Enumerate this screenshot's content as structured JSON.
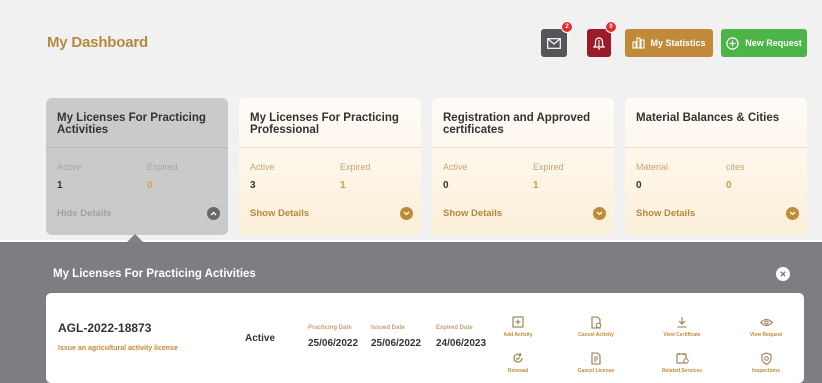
{
  "header": {
    "title": "My Dashboard",
    "mail_badge": "2",
    "notif_badge": "0",
    "stats_label": "My Statistics",
    "new_request_label": "New Request"
  },
  "cards": [
    {
      "title": "My Licenses For Practicing Activities",
      "label1": "Active",
      "value1": "1",
      "label2": "Expired",
      "value2": "0",
      "details": "Hide Details"
    },
    {
      "title": "My Licenses For Practicing Professional",
      "label1": "Active",
      "value1": "3",
      "label2": "Expired",
      "value2": "1",
      "details": "Show Details"
    },
    {
      "title": "Registration and Approved certificates",
      "label1": "Active",
      "value1": "0",
      "label2": "Expired",
      "value2": "1",
      "details": "Show Details"
    },
    {
      "title": "Material Balances & Cities",
      "label1": "Material",
      "value1": "0",
      "label2": "cites",
      "value2": "0",
      "details": "Show Details"
    }
  ],
  "panel": {
    "title": "My Licenses For Practicing Activities",
    "license": {
      "number": "AGL-2022-18873",
      "description": "Issue an agricultural activity license",
      "status": "Active",
      "practicing_label": "Practicing Date",
      "practicing_date": "25/06/2022",
      "issued_label": "Issued Date",
      "issued_date": "25/06/2022",
      "expired_label": "Expired Date",
      "expired_date": "24/06/2023"
    },
    "actions": [
      "Add Activity",
      "Cancel Activity",
      "View Certificate",
      "View Request",
      "Renewal",
      "Cancel License",
      "Related Services",
      "Inspections"
    ]
  },
  "colors": {
    "brand": "#b5883e",
    "green": "#4db447",
    "red": "#9b1b2b",
    "panel": "#7c7e81"
  }
}
